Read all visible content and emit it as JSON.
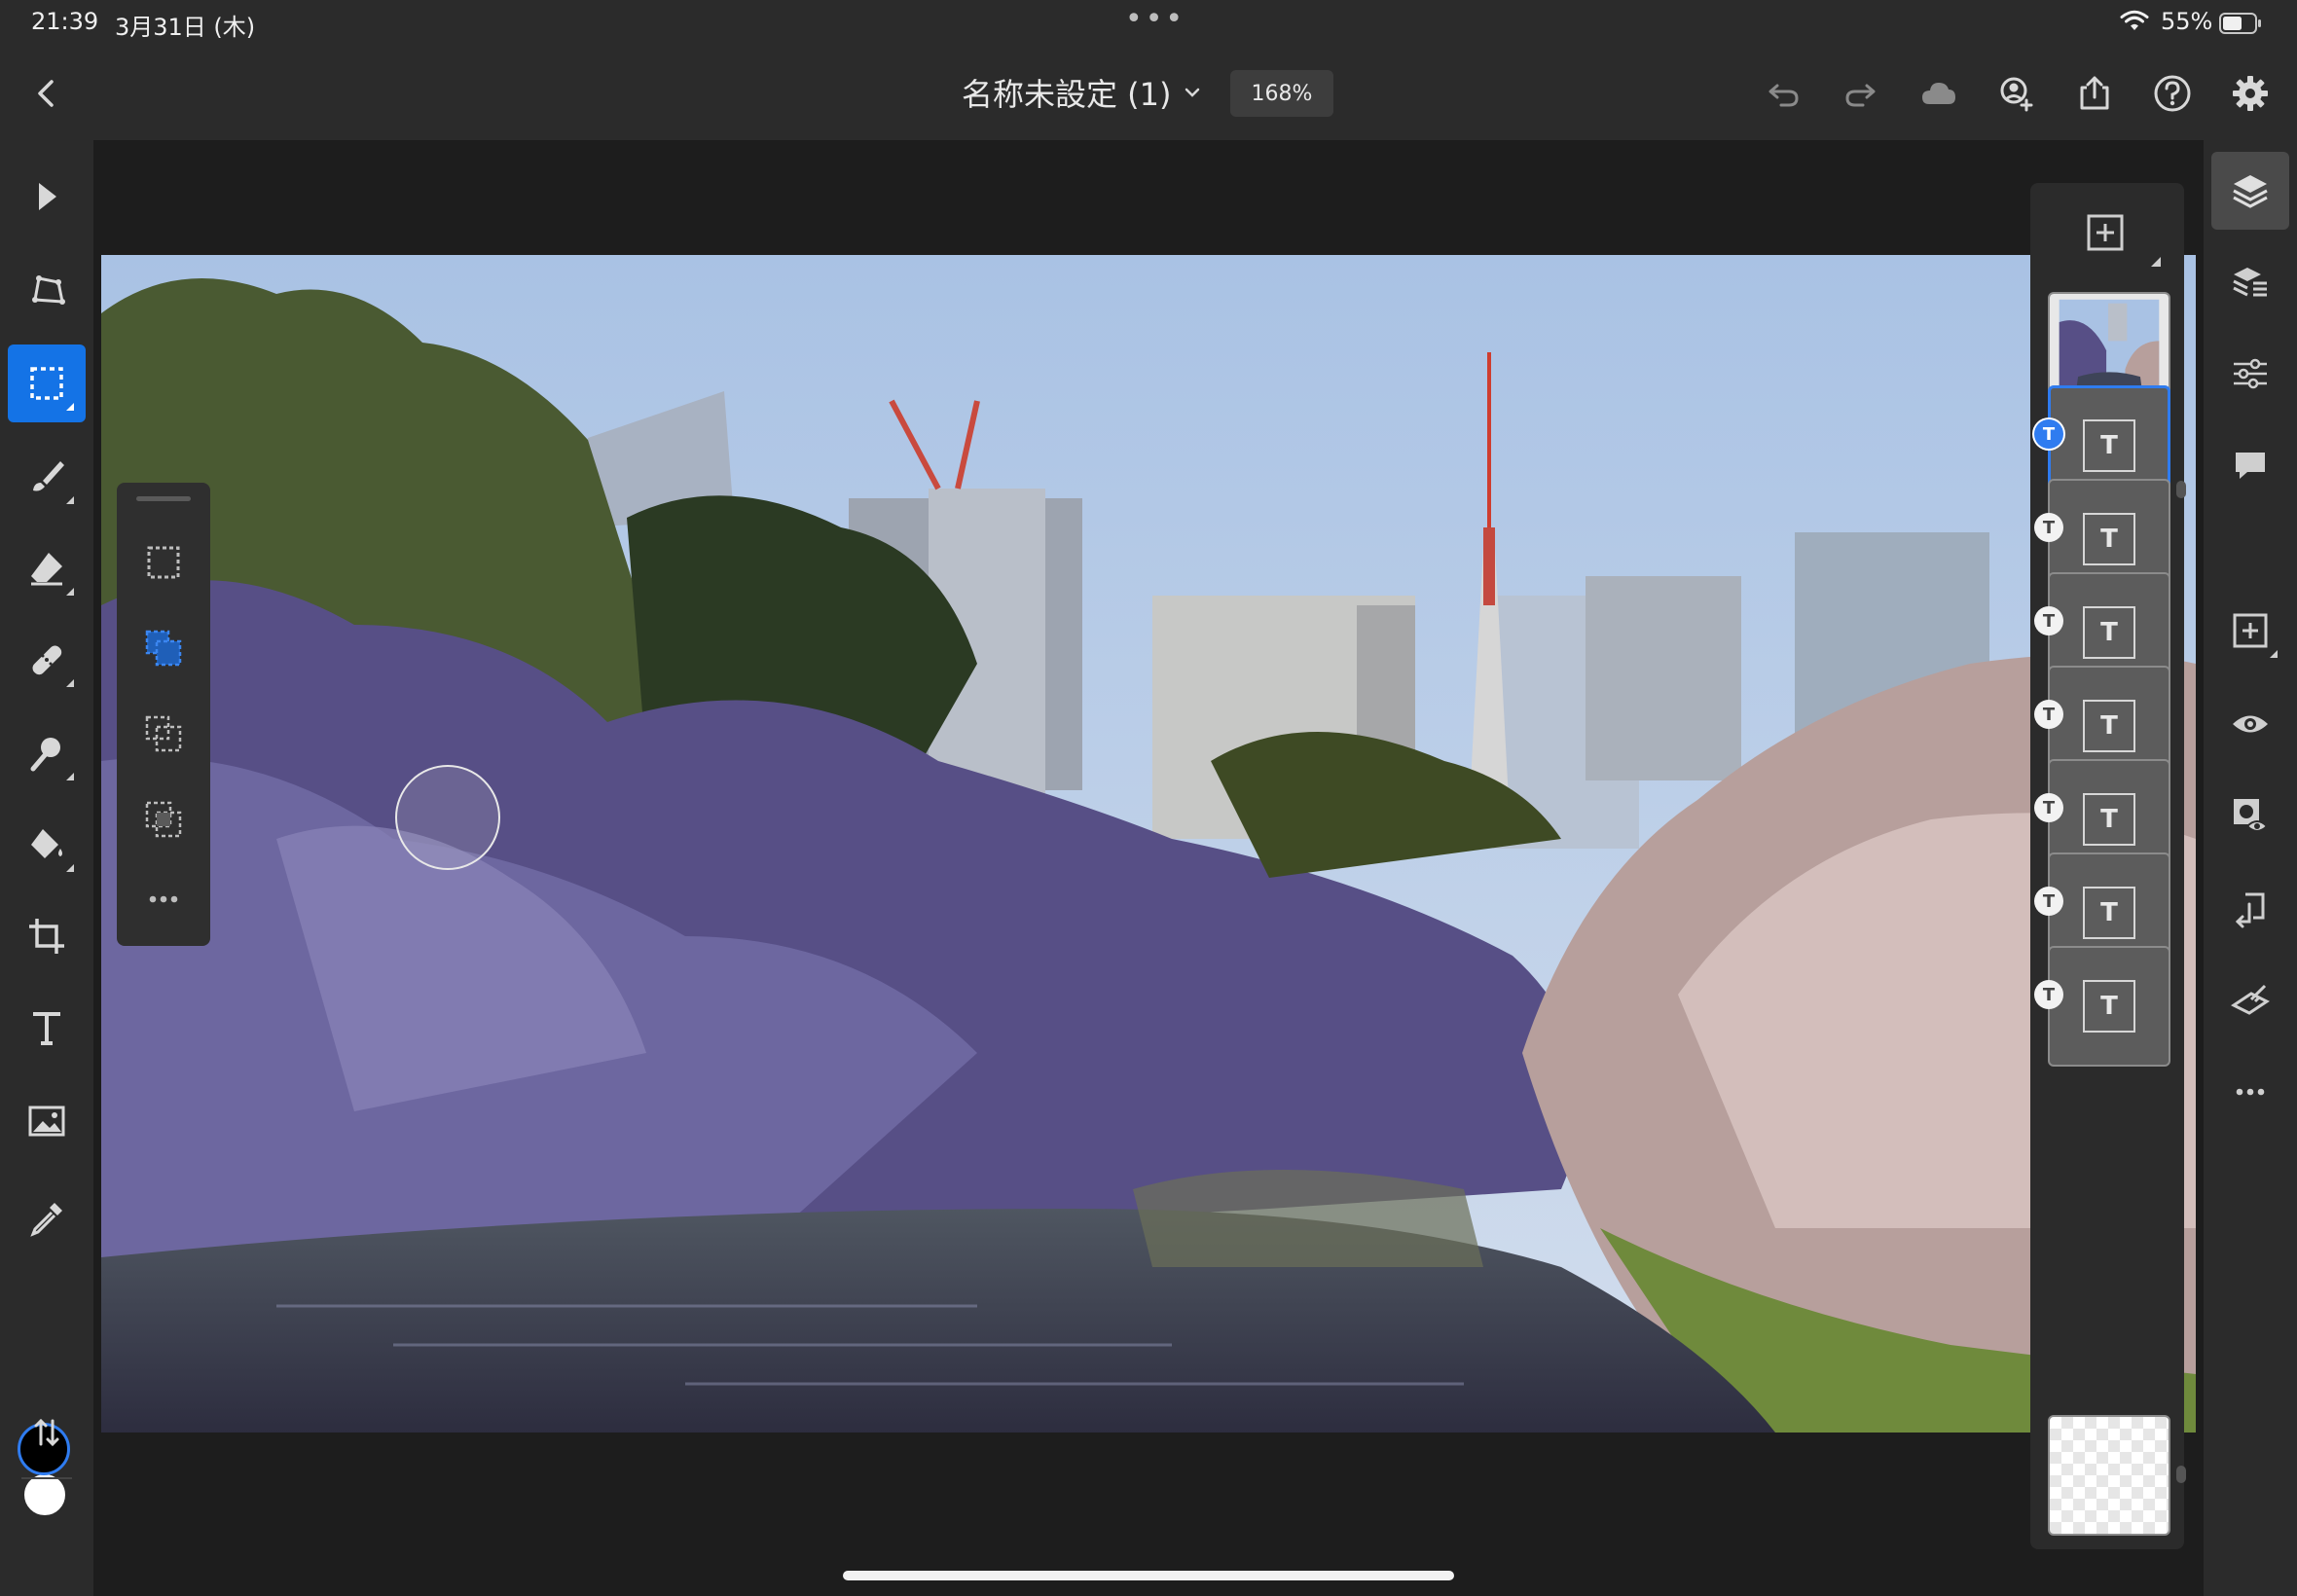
{
  "status_bar": {
    "time": "21:39",
    "date": "3月31日 (木)",
    "battery": "55%",
    "dots": "•••"
  },
  "header": {
    "document_title": "名称未設定 (1)",
    "zoom": "168%"
  },
  "left_toolbar": {
    "tools": [
      "select-tool",
      "transform-tool",
      "marquee-tool",
      "brush-tool",
      "eraser-tool",
      "healing-tool",
      "clone-tool",
      "fill-tool",
      "crop-tool",
      "text-tool",
      "image-tool",
      "eyedropper-tool"
    ],
    "active_tool": "marquee-tool",
    "foreground_color": "#000000",
    "background_color": "#ffffff"
  },
  "selection_flyout": {
    "options": [
      "new-selection",
      "add-to-selection",
      "subtract-from-selection",
      "intersect-selection",
      "more"
    ]
  },
  "layers": {
    "items": [
      {
        "type": "image",
        "selected": false,
        "tag": ""
      },
      {
        "type": "text",
        "selected": true,
        "tag": "T",
        "label": "T"
      },
      {
        "type": "text",
        "selected": false,
        "tag": "T",
        "label": "T"
      },
      {
        "type": "text",
        "selected": false,
        "tag": "T",
        "label": "T"
      },
      {
        "type": "text",
        "selected": false,
        "tag": "T",
        "label": "T"
      },
      {
        "type": "text",
        "selected": false,
        "tag": "T",
        "label": "T"
      },
      {
        "type": "text",
        "selected": false,
        "tag": "T",
        "label": "T"
      },
      {
        "type": "text",
        "selected": false,
        "tag": "T",
        "label": "T"
      },
      {
        "type": "empty",
        "selected": false,
        "tag": ""
      }
    ]
  },
  "right_rail": {
    "buttons": [
      "layers-icon",
      "layer-properties-icon",
      "adjustments-icon",
      "comments-icon",
      "add-layer-icon",
      "visibility-icon",
      "mask-icon",
      "merge-icon",
      "clear-icon",
      "more-icon"
    ],
    "active": "layers-icon"
  },
  "colors": {
    "accent": "#1473e6",
    "panel": "#2b2b2b",
    "canvas": "#1d1d1d"
  }
}
